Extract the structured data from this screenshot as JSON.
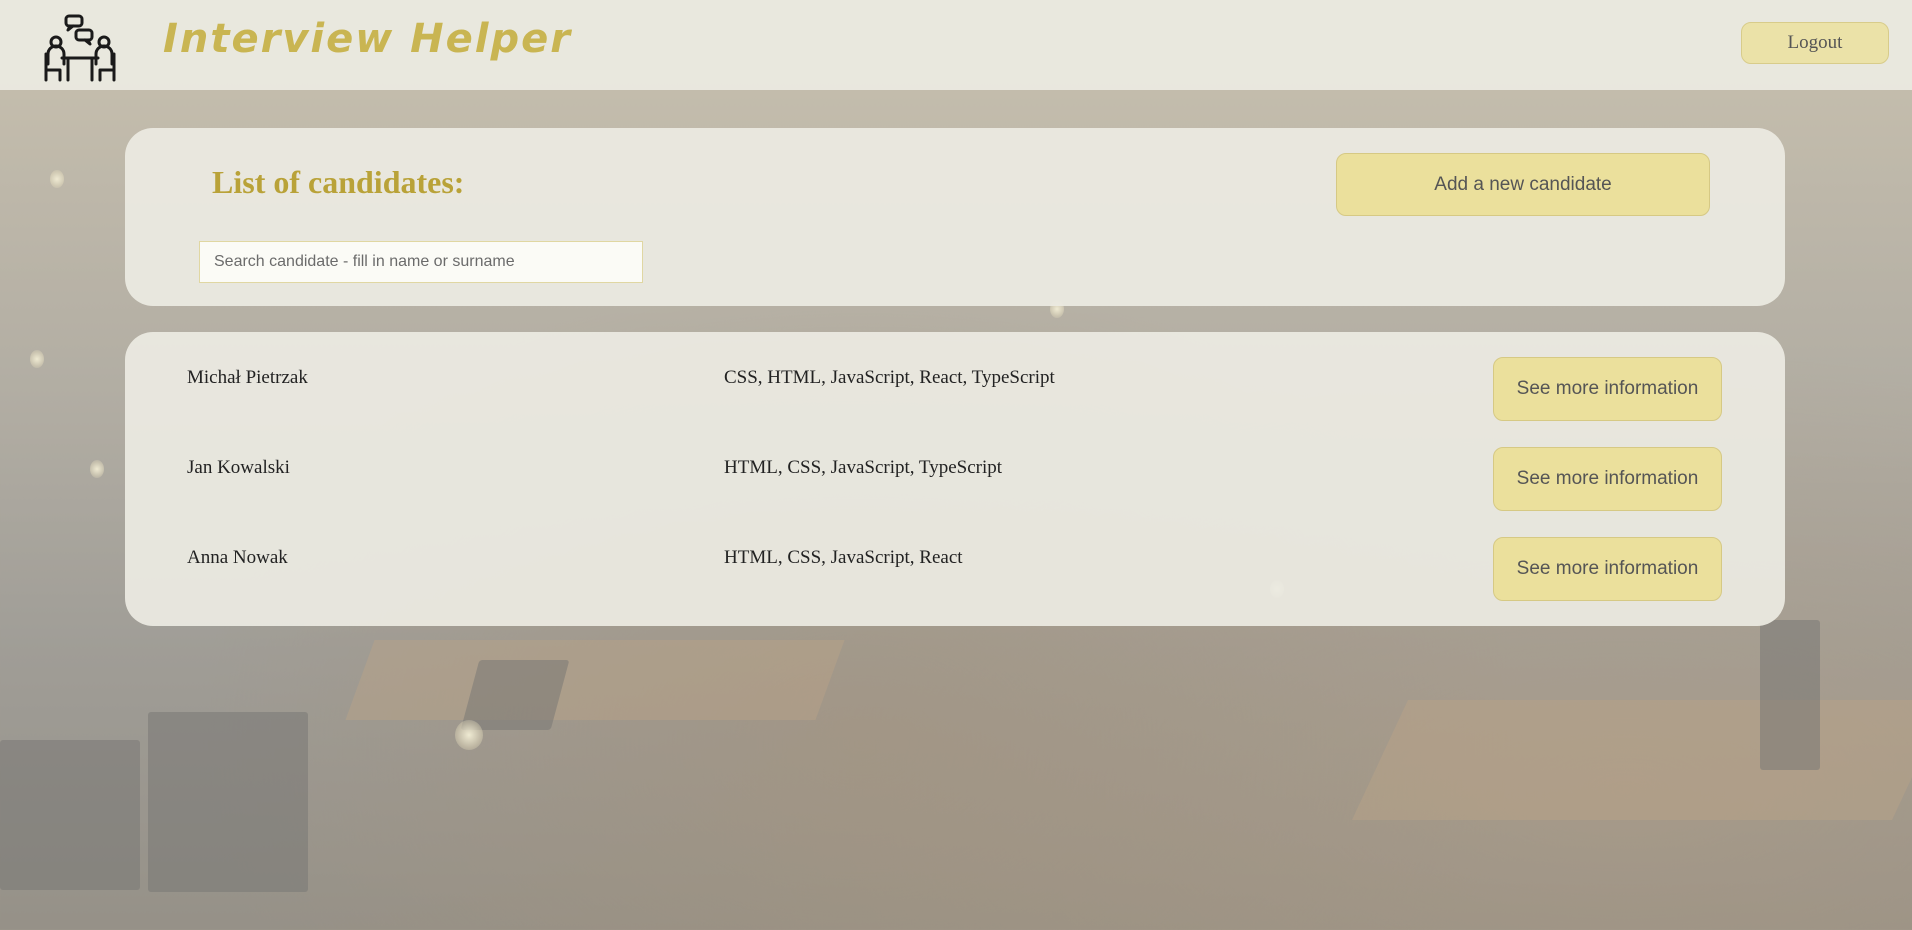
{
  "header": {
    "app_title": "Interview Helper",
    "logout_label": "Logout"
  },
  "candidates_panel": {
    "title": "List of candidates:",
    "add_button_label": "Add a new candidate",
    "search": {
      "placeholder": "Search candidate - fill in name or surname",
      "value": ""
    }
  },
  "candidates": [
    {
      "name": "Michał Pietrzak",
      "skills": "CSS, HTML, JavaScript, React, TypeScript",
      "button_label": "See more information"
    },
    {
      "name": "Jan Kowalski",
      "skills": "HTML, CSS, JavaScript, TypeScript",
      "button_label": "See more information"
    },
    {
      "name": "Anna Nowak",
      "skills": "HTML, CSS, JavaScript, React",
      "button_label": "See more information"
    }
  ],
  "colors": {
    "accent_gold": "#b9a238",
    "button_fill": "#ebe09c",
    "panel_bg": "#ecebe2"
  },
  "icons": {
    "logo": "interview-people-icon"
  }
}
